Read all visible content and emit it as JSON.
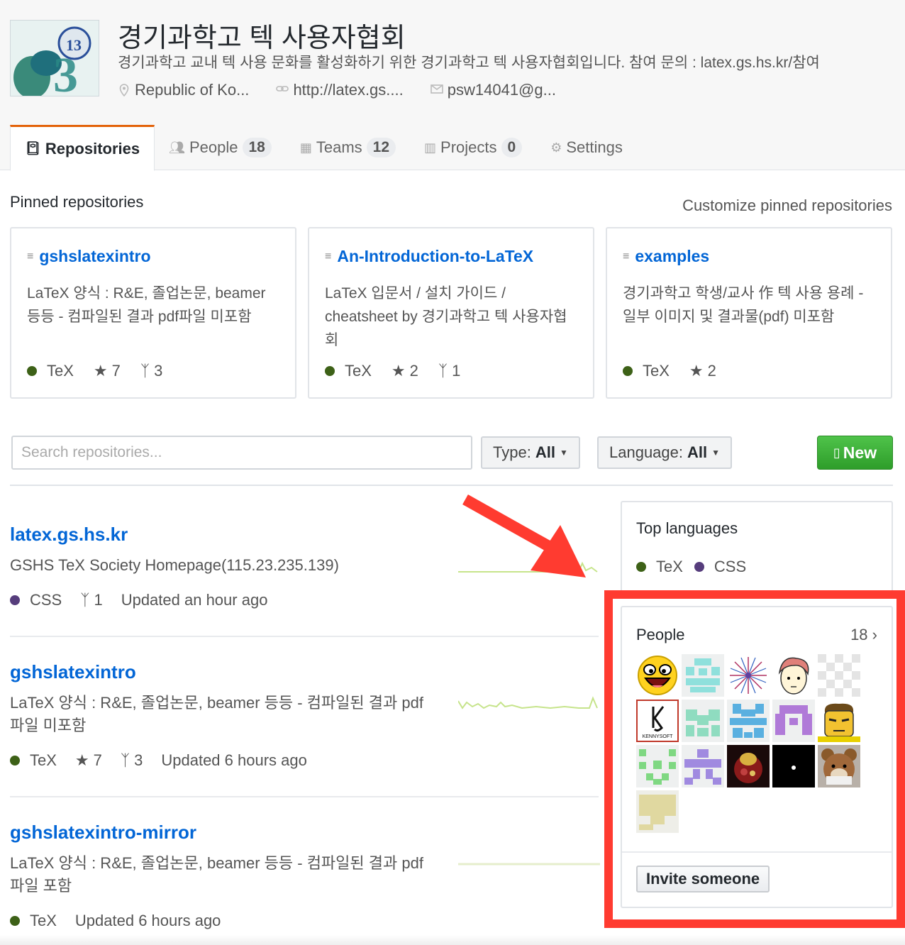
{
  "org": {
    "name": "경기과학고 텍 사용자협회",
    "description": "경기과학고 교내 텍 사용 문화를 활성화하기 위한 경기과학고 텍 사용자협회입니다. 참여 문의 : latex.gs.hs.kr/참여",
    "location": "Republic of Ko...",
    "website": "http://latex.gs....",
    "email": "psw14041@g...",
    "logo_text": "13"
  },
  "tabs": [
    {
      "label": "Repositories",
      "count": ""
    },
    {
      "label": "People",
      "count": "18"
    },
    {
      "label": "Teams",
      "count": "12"
    },
    {
      "label": "Projects",
      "count": "0"
    },
    {
      "label": "Settings",
      "count": ""
    }
  ],
  "pinned": {
    "title": "Pinned repositories",
    "customize": "Customize pinned repositories",
    "cards": [
      {
        "name": "gshslatexintro",
        "desc": "LaTeX 양식 : R&E, 졸업논문, beamer 등등 - 컴파일된 결과 pdf파일 미포함",
        "lang": "TeX",
        "stars": "7",
        "forks": "3"
      },
      {
        "name": "An-Introduction-to-LaTeX",
        "desc": "LaTeX 입문서 / 설치 가이드 / cheatsheet by 경기과학고 텍 사용자협회",
        "lang": "TeX",
        "stars": "2",
        "forks": "1"
      },
      {
        "name": "examples",
        "desc": "경기과학고 학생/교사 作 텍 사용 용례 - 일부 이미지 및 결과물(pdf) 미포함",
        "lang": "TeX",
        "stars": "2",
        "forks": ""
      }
    ]
  },
  "filters": {
    "search_placeholder": "Search repositories...",
    "type_label": "Type:",
    "type_value": "All",
    "language_label": "Language:",
    "language_value": "All",
    "new_label": "New"
  },
  "repos": [
    {
      "name": "latex.gs.hs.kr",
      "desc": "GSHS TeX Society Homepage(115.23.235.139)",
      "lang": "CSS",
      "stars": "",
      "forks": "1",
      "updated": "Updated an hour ago"
    },
    {
      "name": "gshslatexintro",
      "desc": "LaTeX 양식 : R&E, 졸업논문, beamer 등등 - 컴파일된 결과 pdf파일 미포함",
      "lang": "TeX",
      "stars": "7",
      "forks": "3",
      "updated": "Updated 6 hours ago"
    },
    {
      "name": "gshslatexintro-mirror",
      "desc": "LaTeX 양식 : R&E, 졸업논문, beamer 등등 - 컴파일된 결과 pdf파일 포함",
      "lang": "TeX",
      "stars": "",
      "forks": "",
      "updated": "Updated 6 hours ago"
    }
  ],
  "sidebar": {
    "top_languages_title": "Top languages",
    "languages": [
      "TeX",
      "CSS"
    ],
    "people_title": "People",
    "people_count": "18",
    "invite_label": "Invite someone",
    "kennysoft_label": "KENNYSOFT"
  },
  "colors": {
    "tex": "#3D6117",
    "css": "#563d7c",
    "link": "#0366d6",
    "highlight": "#ff3b30"
  }
}
